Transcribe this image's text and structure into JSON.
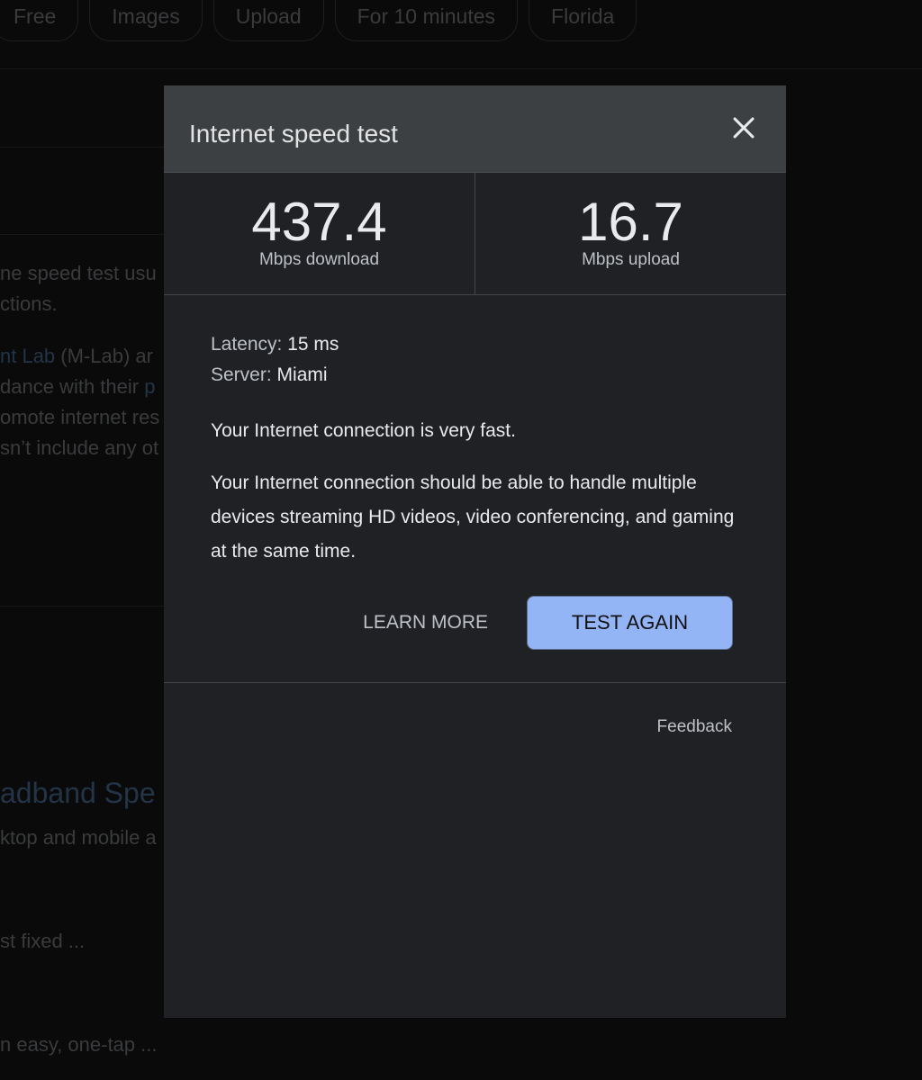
{
  "background": {
    "chips": [
      "Free",
      "Images",
      "Upload",
      "For 10 minutes",
      "Florida"
    ],
    "snippets": [
      {
        "pre": "",
        "link": "",
        "post": "ne speed test usu"
      },
      {
        "pre": "",
        "link": "",
        "post": "ctions."
      },
      {
        "pre": "",
        "link": "nt Lab",
        "post": " (M-Lab) ar"
      },
      {
        "pre": "dance with their ",
        "link": "p",
        "post": ""
      },
      {
        "pre": "",
        "link": "",
        "post": "omote internet res"
      },
      {
        "pre": "",
        "link": "",
        "post": "sn’t include any ot"
      }
    ],
    "result_title": "adband Spe",
    "result_lines": [
      "ktop and mobile a",
      "st fixed ...",
      "n easy, one-tap ..."
    ]
  },
  "dialog": {
    "title": "Internet speed test",
    "close_icon": "close-icon",
    "download": {
      "value": "437.4",
      "unit": "Mbps download"
    },
    "upload": {
      "value": "16.7",
      "unit": "Mbps upload"
    },
    "latency_label": "Latency:",
    "latency_value": "15 ms",
    "server_label": "Server:",
    "server_value": "Miami",
    "summary": "Your Internet connection is very fast.",
    "detail": "Your Internet connection should be able to handle multiple devices streaming HD videos, video conferencing, and gaming at the same time.",
    "learn_more": "LEARN MORE",
    "test_again": "TEST AGAIN",
    "feedback": "Feedback",
    "accent": "#8ab4f8"
  }
}
